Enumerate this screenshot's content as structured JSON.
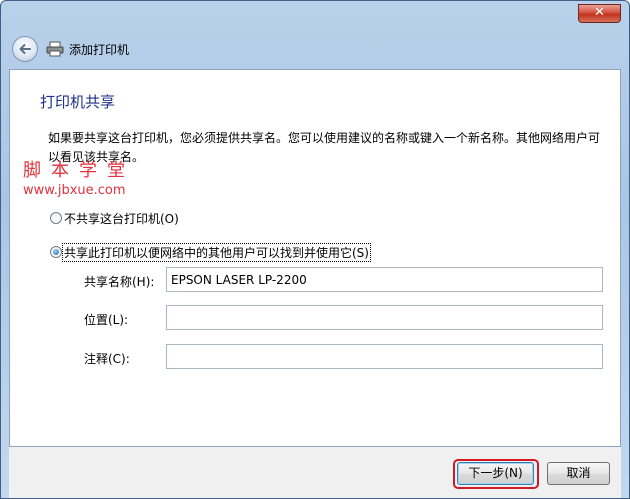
{
  "window": {
    "title": "添加打印机",
    "close_symbol": "✕",
    "icons": {
      "back": "back-arrow-icon",
      "printer": "printer-icon",
      "close": "close-icon"
    }
  },
  "page": {
    "title": "打印机共享",
    "description": "如果要共享这台打印机，您必须提供共享名。您可以使用建议的名称或键入一个新名称。其他网络用户可以看见该共享名。"
  },
  "watermark": {
    "text": "脚本学堂",
    "url": "www.jbxue.com"
  },
  "options": [
    {
      "label": "不共享这台打印机(O)",
      "checked": false
    },
    {
      "label": "共享此打印机以便网络中的其他用户可以找到并使用它(S)",
      "checked": true
    }
  ],
  "fields": {
    "share_name": {
      "label": "共享名称(H):",
      "value": "EPSON LASER LP-2200"
    },
    "location": {
      "label": "位置(L):",
      "value": ""
    },
    "comment": {
      "label": "注释(C):",
      "value": ""
    }
  },
  "buttons": {
    "next": "下一步(N)",
    "cancel": "取消"
  },
  "colors": {
    "title_blue": "#1e3287",
    "watermark_red": "#e0333d",
    "highlight_red": "#d01a2a"
  }
}
